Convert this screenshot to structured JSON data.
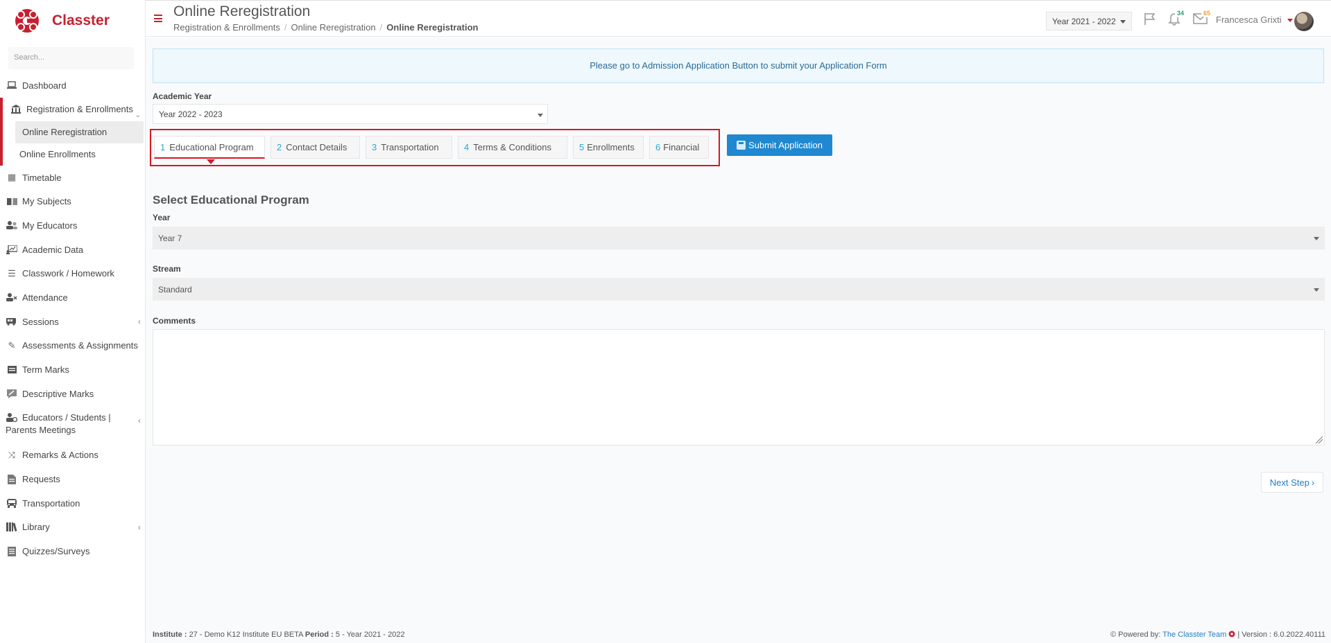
{
  "app": {
    "name": "Classter"
  },
  "sidebar": {
    "search_placeholder": "Search...",
    "items": [
      {
        "label": "Dashboard",
        "icon": "laptop-icon"
      },
      {
        "label": "Registration & Enrollments",
        "icon": "bank-icon"
      },
      {
        "label": "Online Reregistration"
      },
      {
        "label": "Online Enrollments"
      },
      {
        "label": "Timetable",
        "icon": "calendar-icon"
      },
      {
        "label": "My Subjects",
        "icon": "book-icon"
      },
      {
        "label": "My Educators",
        "icon": "users-icon"
      },
      {
        "label": "Academic Data",
        "icon": "chart-board-icon"
      },
      {
        "label": "Classwork / Homework",
        "icon": "list-check-icon"
      },
      {
        "label": "Attendance",
        "icon": "user-x-icon"
      },
      {
        "label": "Sessions",
        "icon": "bus-icon"
      },
      {
        "label": "Assessments & Assignments",
        "icon": "edit-icon"
      },
      {
        "label": "Term Marks",
        "icon": "clipboard-icon"
      },
      {
        "label": "Descriptive Marks",
        "icon": "comment-edit-icon"
      },
      {
        "label": "Educators / Students | Parents Meetings",
        "icon": "meeting-icon"
      },
      {
        "label": "Remarks & Actions",
        "icon": "shuffle-icon"
      },
      {
        "label": "Requests",
        "icon": "document-icon"
      },
      {
        "label": "Transportation",
        "icon": "bus-front-icon"
      },
      {
        "label": "Library",
        "icon": "library-icon"
      },
      {
        "label": "Quizzes/Surveys",
        "icon": "survey-icon"
      }
    ]
  },
  "header": {
    "title": "Online Reregistration",
    "breadcrumb": [
      "Registration & Enrollments",
      "Online Reregistration",
      "Online Reregistration"
    ],
    "year": "Year 2021 - 2022",
    "notifications": "34",
    "messages": "65",
    "user": "Francesca Grixti"
  },
  "main": {
    "alert": "Please go to Admission Application Button to submit your Application Form",
    "academic_year_label": "Academic Year",
    "academic_year_value": "Year 2022 - 2023",
    "steps": [
      {
        "num": "1",
        "label": "Educational Program"
      },
      {
        "num": "2",
        "label": "Contact Details"
      },
      {
        "num": "3",
        "label": "Transportation"
      },
      {
        "num": "4",
        "label": "Terms & Conditions"
      },
      {
        "num": "5",
        "label": "Enrollments"
      },
      {
        "num": "6",
        "label": "Financial"
      }
    ],
    "submit_label": "Submit Application",
    "section_title": "Select Educational Program",
    "year_label": "Year",
    "year_value": "Year 7",
    "stream_label": "Stream",
    "stream_value": "Standard",
    "comments_label": "Comments",
    "next_label": "Next Step"
  },
  "footer": {
    "institute_label": "Institute :",
    "institute_value": "27 - Demo K12 Institute EU BETA",
    "period_label": "Period :",
    "period_value": "5 - Year 2021 - 2022",
    "powered_by": "Powered by:",
    "team": "The Classter Team",
    "version": "| Version : 6.0.2022.40111"
  },
  "colors": {
    "brand": "#c8202f",
    "accent": "#1f88d0",
    "step_number": "#2aa7d8"
  }
}
